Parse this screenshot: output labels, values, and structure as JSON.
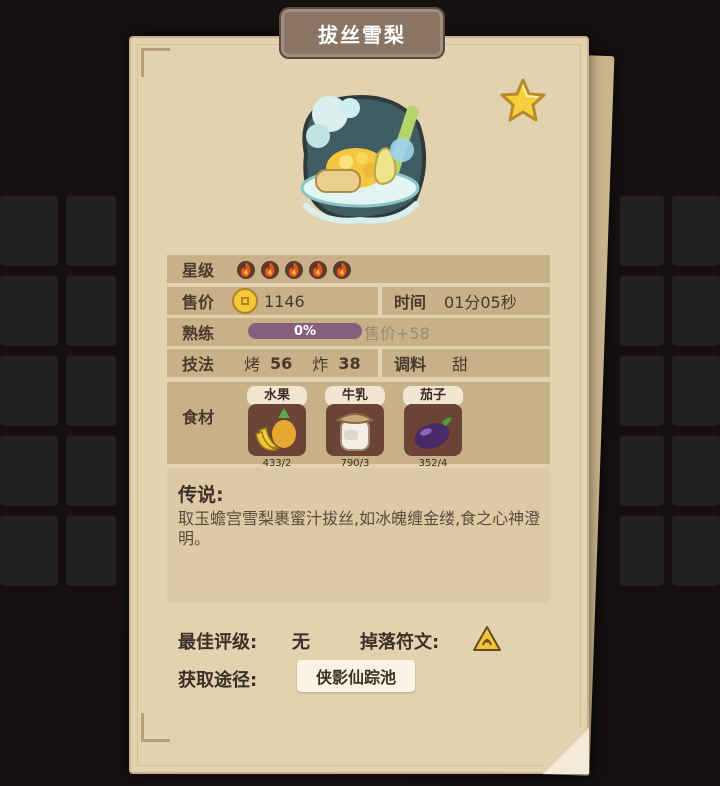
{
  "dish": {
    "name": "拔丝雪梨",
    "star_level_label": "星级",
    "star_level": 5,
    "price_label": "售价",
    "price": "1146",
    "time_label": "时间",
    "time": "01分05秒",
    "proficiency_label": "熟练",
    "proficiency_text": "0%",
    "proficiency_value": 0,
    "proficiency_bonus": "售价+58",
    "technique_label": "技法",
    "tech_1_name": "烤",
    "tech_1_value": "56",
    "tech_2_name": "炸",
    "tech_2_value": "38",
    "seasoning_label": "调料",
    "seasoning": "甜",
    "ingredients_label": "食材",
    "ingredients": [
      {
        "name": "水果",
        "count": "433/2",
        "icon": "fruit-icon"
      },
      {
        "name": "牛乳",
        "count": "790/3",
        "icon": "milk-jar-icon"
      },
      {
        "name": "茄子",
        "count": "352/4",
        "icon": "eggplant-icon"
      }
    ],
    "legend_title": "传说:",
    "legend_text": "取玉蟾宫雪梨裹蜜汁拔丝,如冰魄缠金缕,食之心神澄明。",
    "best_rating_label": "最佳评级:",
    "best_rating": "无",
    "drop_rune_label": "掉落符文:",
    "obtain_label": "获取途径:",
    "obtain_source": "侠影仙踪池"
  },
  "colors": {
    "card": "#e3d2b0",
    "row": "#c8b089",
    "banner": "#8a7565",
    "progress": "#86607a",
    "fire": "#e2541d",
    "star": "#f6cf3f"
  }
}
